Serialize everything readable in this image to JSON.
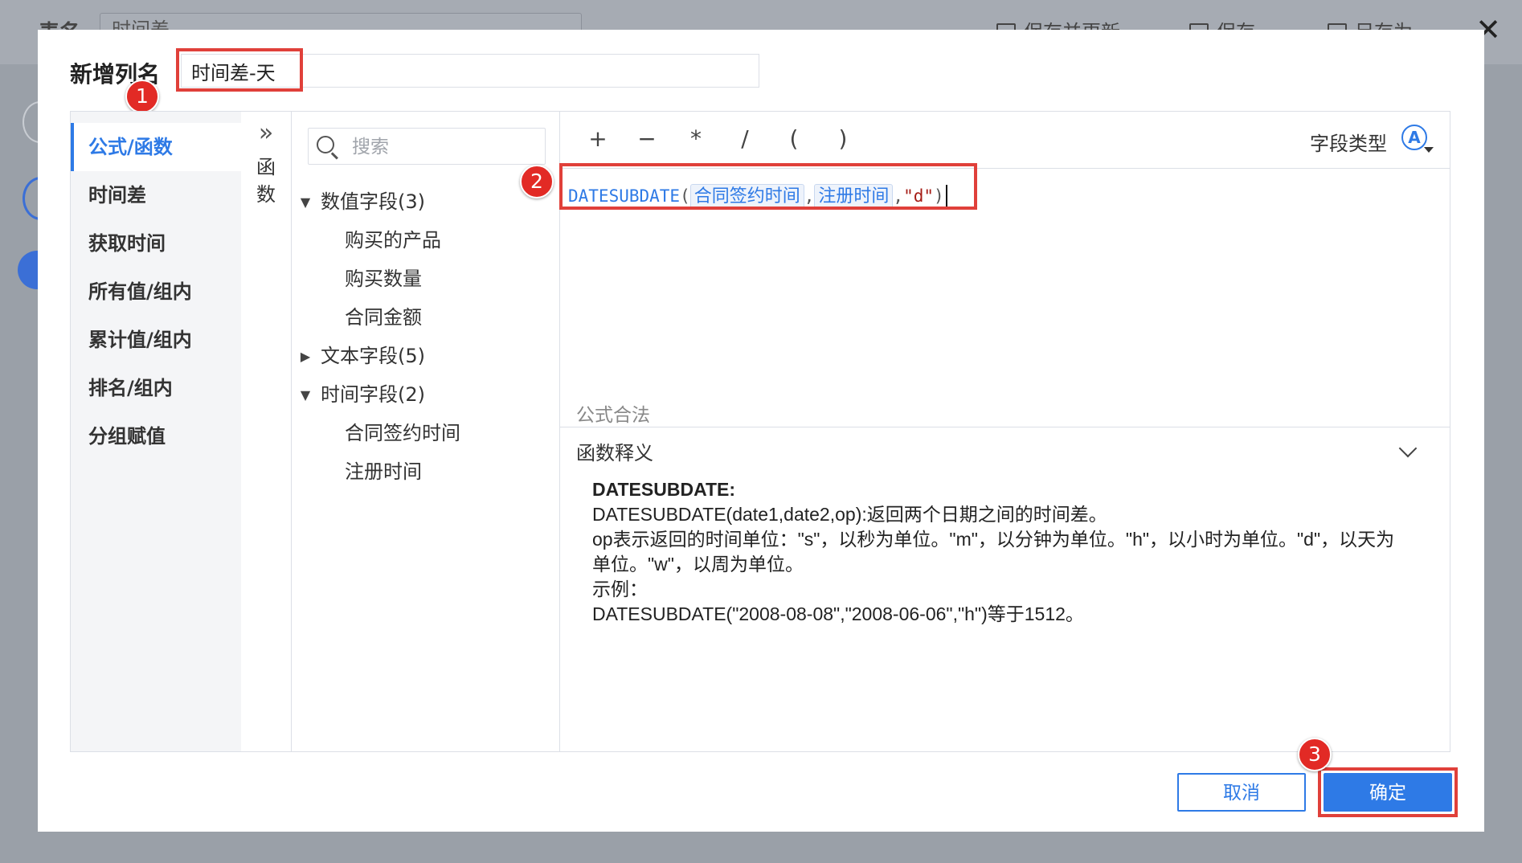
{
  "background": {
    "title": "表名",
    "table_name_value": "时间差",
    "actions": [
      "保存并更新",
      "保存",
      "另存为"
    ]
  },
  "dialog": {
    "name_label": "新增列名",
    "name_value": "时间差-天",
    "categories": [
      "公式/函数",
      "时间差",
      "获取时间",
      "所有值/组内",
      "累计值/组内",
      "排名/组内",
      "分组赋值"
    ],
    "collapse_icon": "double-chevron-right-icon",
    "collapse_label": "函数",
    "search_placeholder": "搜索",
    "field_groups": [
      {
        "label": "数值字段(3)",
        "expanded": true,
        "items": [
          "购买的产品",
          "购买数量",
          "合同金额"
        ]
      },
      {
        "label": "文本字段(5)",
        "expanded": false,
        "items": []
      },
      {
        "label": "时间字段(2)",
        "expanded": true,
        "items": [
          "合同签约时间",
          "注册时间"
        ]
      }
    ],
    "operators": [
      "+",
      "−",
      "*",
      "/",
      "(",
      ")"
    ],
    "field_type_label": "字段类型",
    "field_type_icon": "A",
    "formula": {
      "func": "DATESUBDATE",
      "open": "(",
      "arg1": "合同签约时间",
      "sep1": ",",
      "arg2": "注册时间",
      "sep2": ",",
      "literal": "\"d\"",
      "close": ")"
    },
    "status_text": "公式合法",
    "explain_title": "函数释义",
    "explain_lines": [
      "DATESUBDATE:",
      "DATESUBDATE(date1,date2,op):返回两个日期之间的时间差。",
      "op表示返回的时间单位：\"s\"，以秒为单位。\"m\"，以分钟为单位。\"h\"，以小时为单位。\"d\"，以天为单位。\"w\"，以周为单位。",
      "示例：",
      "DATESUBDATE(\"2008-08-08\",\"2008-06-06\",\"h\")等于1512。"
    ],
    "cancel_label": "取消",
    "ok_label": "确定"
  },
  "annotations": [
    "1",
    "2",
    "3"
  ],
  "colors": {
    "accent": "#2e7ae6",
    "highlight": "#e0403a",
    "badge": "#e22a25"
  }
}
